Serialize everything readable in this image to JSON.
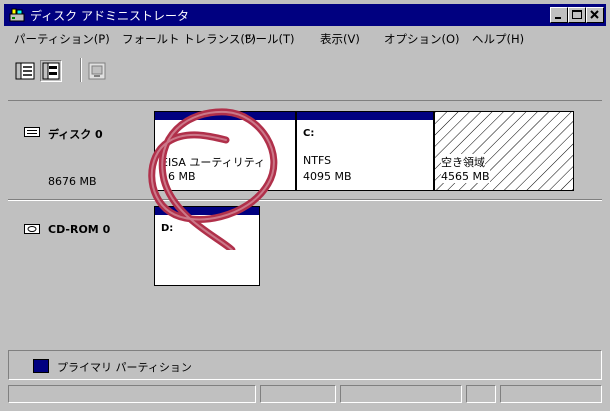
{
  "window": {
    "title": "ディスク アドミニストレータ"
  },
  "menu": [
    "パーティション(P)",
    "フォールト トレランス(F)",
    "ツール(T)",
    "表示(V)",
    "オプション(O)",
    "ヘルプ(H)"
  ],
  "toolbar": {
    "icons": [
      "volumes-view-icon",
      "disk-config-view-icon",
      "properties-icon"
    ]
  },
  "disks": [
    {
      "name": "ディスク 0",
      "size": "8676 MB"
    },
    {
      "name": "CD-ROM 0"
    }
  ],
  "partitions": [
    {
      "label": "EISA ユーティリティ",
      "size": "16 MB"
    },
    {
      "drive": "C:",
      "fs": "NTFS",
      "size": "4095 MB"
    },
    {
      "label": "空き領域",
      "size": "4565 MB"
    },
    {
      "drive": "D:"
    }
  ],
  "legend": {
    "label": "プライマリ パーティション",
    "color": "#000080"
  },
  "colors": {
    "titlebar": "#000080",
    "face": "#c0c0c0",
    "annotation": "#b0304a"
  }
}
